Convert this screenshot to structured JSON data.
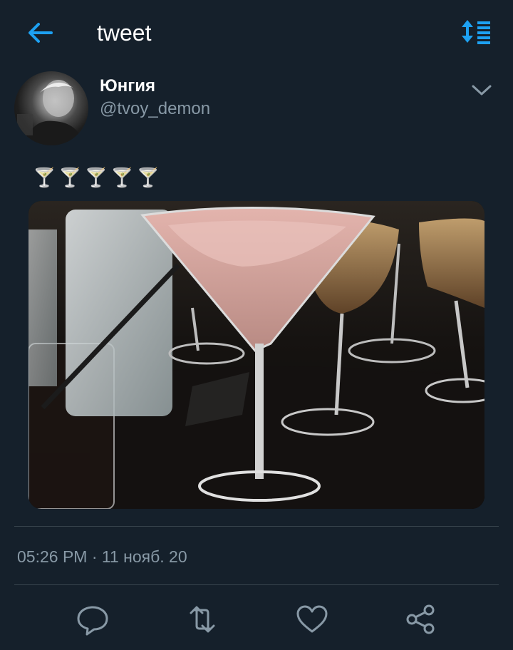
{
  "header": {
    "title": "tweet",
    "back_icon": "arrow-left-icon",
    "sort_icon": "sort-icon",
    "accent_color": "#1da1f2"
  },
  "tweet": {
    "author": {
      "display_name": "Юнгия",
      "handle": "@tvoy_demon"
    },
    "text": "🍸🍸🍸🍸🍸",
    "media": {
      "kind": "photo",
      "subject": "cocktail glasses"
    },
    "timestamp": "05:26 PM · 11 нояб. 20"
  },
  "actions": {
    "reply_icon": "reply-icon",
    "retweet_icon": "retweet-icon",
    "like_icon": "heart-icon",
    "share_icon": "share-icon"
  },
  "theme": {
    "background": "#15202b",
    "text_primary": "#ffffff",
    "text_secondary": "#8899a6",
    "divider": "#38444d"
  }
}
